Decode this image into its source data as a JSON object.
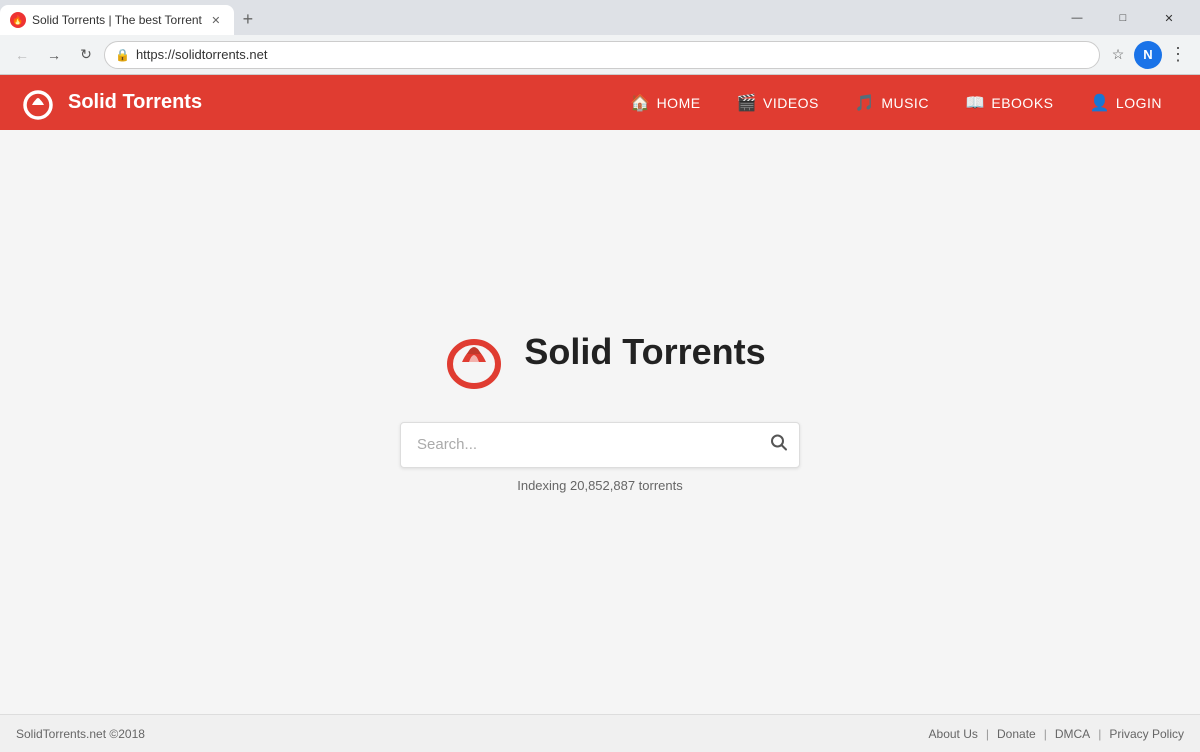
{
  "browser": {
    "tab": {
      "title": "Solid Torrents | The best Torrent",
      "favicon": "🔥"
    },
    "url": "https://solidtorrents.net",
    "profile_initial": "N",
    "new_tab_label": "+"
  },
  "header": {
    "site_name": "Solid Torrents",
    "nav": [
      {
        "label": "HOME",
        "icon": "🏠"
      },
      {
        "label": "VIDEOS",
        "icon": "🎬"
      },
      {
        "label": "MUSIC",
        "icon": "🎵"
      },
      {
        "label": "EBOOKS",
        "icon": "📖"
      },
      {
        "label": "LOGIN",
        "icon": "👤"
      }
    ]
  },
  "main": {
    "logo_text": "Solid Torrents",
    "search_placeholder": "Search...",
    "indexing_text": "Indexing 20,852,887 torrents"
  },
  "footer": {
    "copyright": "SolidTorrents.net ©2018",
    "links": [
      "About Us",
      "Donate",
      "DMCA",
      "Privacy Policy"
    ]
  },
  "colors": {
    "brand_red": "#e03c31",
    "accent_blue": "#1a73e8"
  }
}
